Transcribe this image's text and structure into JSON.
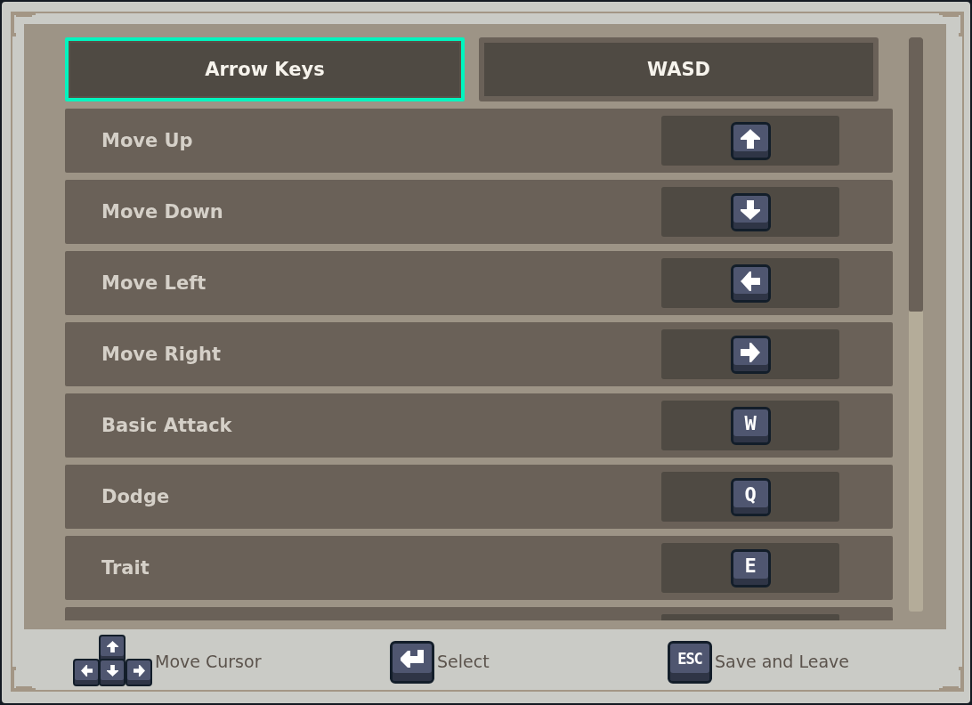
{
  "tabs": [
    {
      "label": "Arrow Keys",
      "selected": true
    },
    {
      "label": "WASD",
      "selected": false
    }
  ],
  "bindings": [
    {
      "action": "Move Up",
      "key": {
        "kind": "arrow_up"
      }
    },
    {
      "action": "Move Down",
      "key": {
        "kind": "arrow_down"
      }
    },
    {
      "action": "Move Left",
      "key": {
        "kind": "arrow_left"
      }
    },
    {
      "action": "Move Right",
      "key": {
        "kind": "arrow_right"
      }
    },
    {
      "action": "Basic Attack",
      "key": {
        "kind": "letter",
        "text": "W"
      }
    },
    {
      "action": "Dodge",
      "key": {
        "kind": "letter",
        "text": "Q"
      }
    },
    {
      "action": "Trait",
      "key": {
        "kind": "letter",
        "text": "E"
      }
    }
  ],
  "footer_hints": [
    {
      "kind": "arrow_cluster",
      "text": "Move Cursor"
    },
    {
      "kind": "enter",
      "text": "Select"
    },
    {
      "kind": "key",
      "key_text": "ESC",
      "text": "Save and Leave"
    }
  ]
}
